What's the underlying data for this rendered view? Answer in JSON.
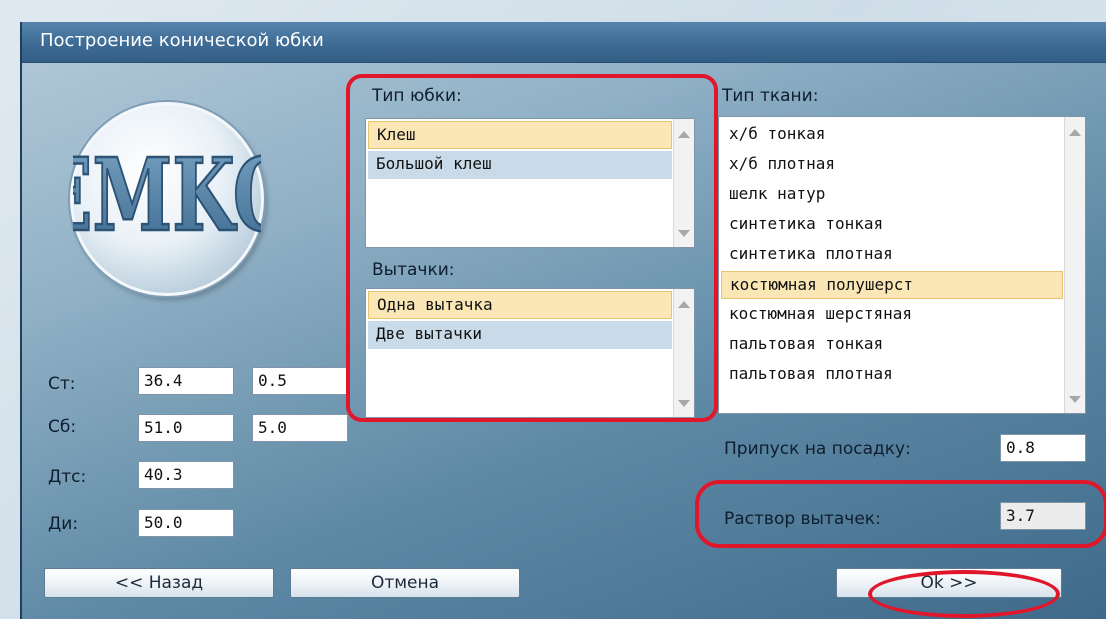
{
  "window": {
    "title": "Построение конической юбки"
  },
  "skirt_type": {
    "label": "Тип юбки:",
    "items": [
      "Клеш",
      "Большой клеш"
    ],
    "selected_index": 0
  },
  "darts": {
    "label": "Вытачки:",
    "items": [
      "Одна вытачка",
      "Две вытачки"
    ],
    "selected_index": 0
  },
  "fabric_type": {
    "label": "Тип ткани:",
    "items": [
      "х/б тонкая",
      "х/б плотная",
      "шелк натур",
      "синтетика тонкая",
      "синтетика плотная",
      "костюмная полушерст",
      "костюмная шерстяная",
      "пальтовая тонкая",
      "пальтовая плотная"
    ],
    "selected_index": 5
  },
  "measurements": [
    {
      "label": "Ст:",
      "value": "36.4",
      "extra": "0.5"
    },
    {
      "label": "Сб:",
      "value": "51.0",
      "extra": "5.0"
    },
    {
      "label": "Дтс:",
      "value": "40.3"
    },
    {
      "label": "Ди:",
      "value": "50.0"
    }
  ],
  "allowance": {
    "label": "Припуск на посадку:",
    "value": "0.8"
  },
  "dart_opening": {
    "label": "Раствор вытачек:",
    "value": "3.7"
  },
  "buttons": {
    "back": "<< Назад",
    "cancel": "Отмена",
    "ok": "Ok >>"
  },
  "colors": {
    "annotation": "#e0162b",
    "selection": "#fbe7b5",
    "title_bar": "#3e6b94"
  },
  "logo": {
    "text": "EMKO",
    "icon": "emko-logo-icon"
  }
}
